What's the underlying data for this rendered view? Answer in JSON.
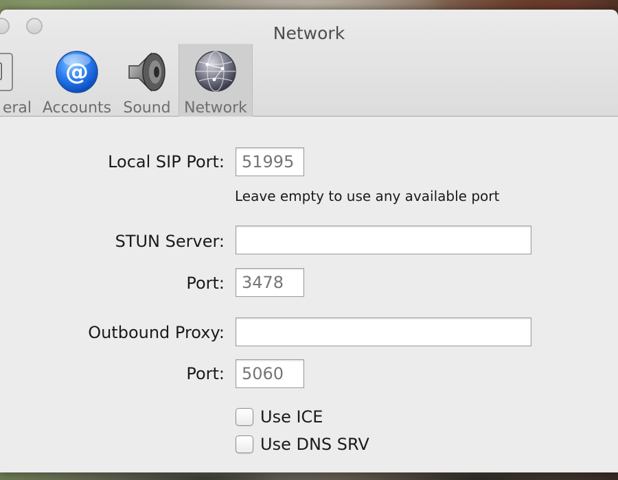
{
  "window": {
    "title": "Network"
  },
  "toolbar": {
    "tabs": [
      {
        "label": "General",
        "visible_label": "eral",
        "icon": "general-switch-icon"
      },
      {
        "label": "Accounts",
        "icon": "at-sign-icon",
        "color": "#2a7cf0"
      },
      {
        "label": "Sound",
        "icon": "speaker-icon"
      },
      {
        "label": "Network",
        "icon": "globe-icon",
        "selected": true
      }
    ]
  },
  "form": {
    "local_sip_port": {
      "label": "Local SIP Port:",
      "value": "",
      "placeholder": "51995"
    },
    "hint": "Leave empty to use any available port",
    "stun_server": {
      "label": "STUN Server:",
      "value": ""
    },
    "stun_port": {
      "label": "Port:",
      "value": "",
      "placeholder": "3478"
    },
    "outbound_proxy": {
      "label": "Outbound Proxy:",
      "value": ""
    },
    "proxy_port": {
      "label": "Port:",
      "value": "",
      "placeholder": "5060"
    },
    "use_ice": {
      "label": "Use ICE",
      "checked": false
    },
    "use_dns_srv": {
      "label": "Use DNS SRV",
      "checked": false
    }
  }
}
